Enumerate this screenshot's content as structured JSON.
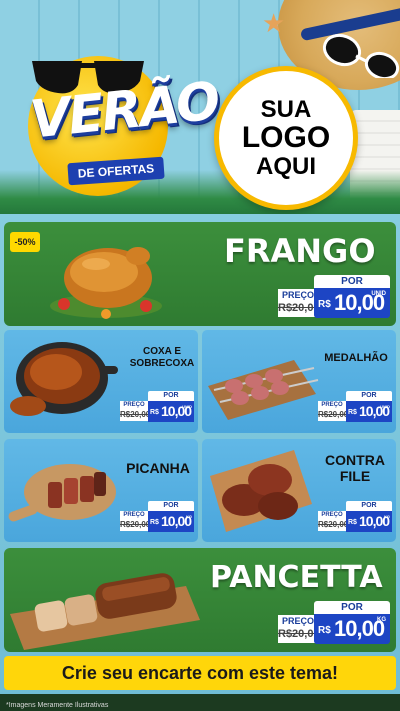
{
  "header": {
    "title": "VERÃO",
    "subtitle": "DE OFERTAS",
    "logo_placeholder": [
      "SUA",
      "LOGO",
      "AQUI"
    ]
  },
  "featured_1": {
    "name": "FRANGO",
    "discount": "-50%",
    "por": "POR",
    "preco": "PREÇO",
    "old_price": "R$20,00",
    "currency": "R$",
    "new_price": "10,00",
    "unit": "UNID"
  },
  "grid": [
    {
      "name": "COXA E SOBRECOXA",
      "por": "POR",
      "preco": "PREÇO",
      "old_price": "R$20,00",
      "currency": "R$",
      "new_price": "10,00",
      "unit": "UNID"
    },
    {
      "name": "MEDALHÃO",
      "por": "POR",
      "preco": "PREÇO",
      "old_price": "R$20,00",
      "currency": "R$",
      "new_price": "10,00",
      "unit": "UNID"
    },
    {
      "name": "PICANHA",
      "por": "POR",
      "preco": "PREÇO",
      "old_price": "R$20,00",
      "currency": "R$",
      "new_price": "10,00",
      "unit": "KG"
    },
    {
      "name": "CONTRA FILE",
      "por": "POR",
      "preco": "PREÇO",
      "old_price": "R$20,00",
      "currency": "R$",
      "new_price": "10,00",
      "unit": "KG"
    }
  ],
  "featured_2": {
    "name": "PANCETTA",
    "por": "POR",
    "preco": "PREÇO",
    "old_price": "R$20,00",
    "currency": "R$",
    "new_price": "10,00",
    "unit": "KG"
  },
  "banner": {
    "text": "Crie seu encarte com este tema!"
  },
  "footer": {
    "disclaimer": "*Imagens Meramente Ilustrativas"
  },
  "colors": {
    "green": "#2f7b31",
    "blue_card": "#4aa6dc",
    "price_blue": "#1d45c4",
    "yellow": "#ffd60a"
  },
  "icons": [
    "sunglasses-icon",
    "sun-icon",
    "hat-icon",
    "starfish-icon",
    "chicken-image",
    "steak-image"
  ]
}
